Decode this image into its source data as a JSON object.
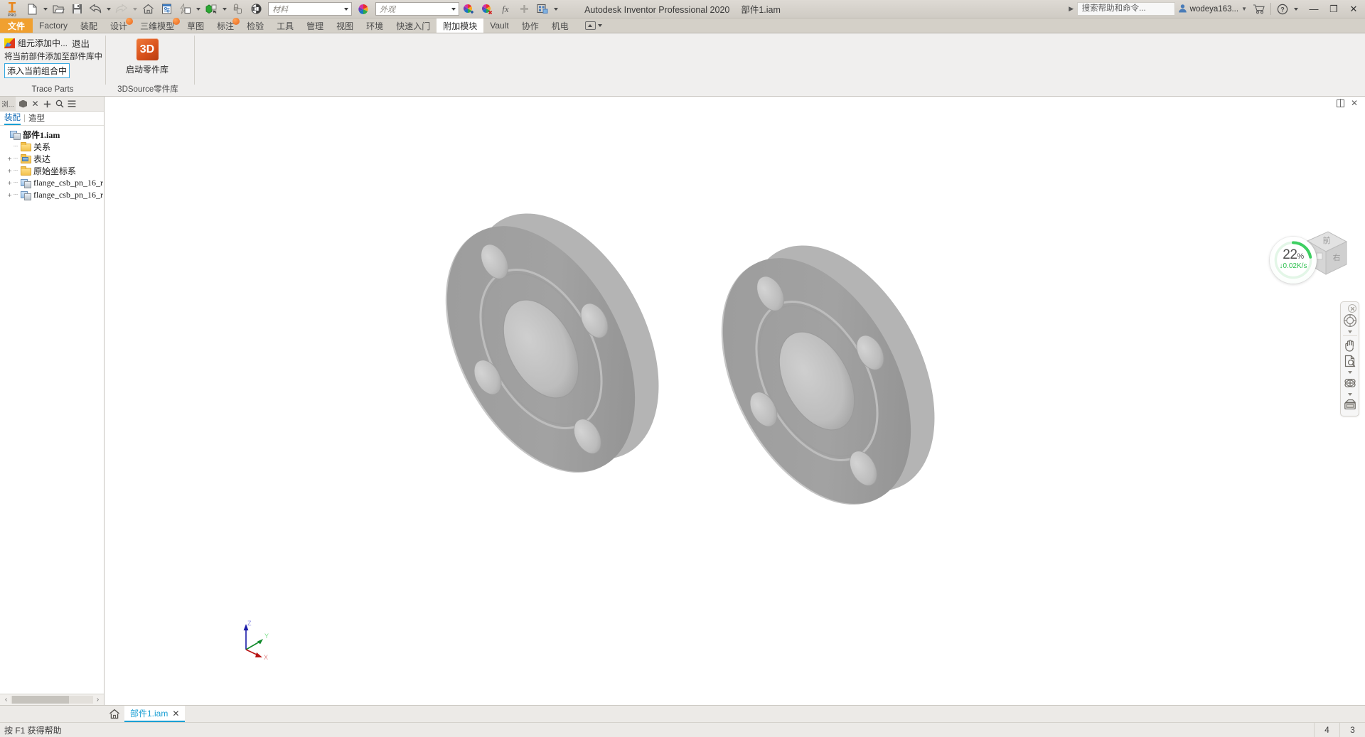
{
  "app": {
    "title": "Autodesk Inventor Professional 2020",
    "document_name": "部件1.iam"
  },
  "quick_access": {
    "logo_label": "PRO",
    "buttons": [
      {
        "name": "new-file",
        "icon": "new-document-icon"
      },
      {
        "name": "open-file",
        "icon": "open-folder-icon"
      },
      {
        "name": "save-file",
        "icon": "save-disk-icon"
      },
      {
        "name": "undo",
        "icon": "undo-arrow-icon"
      },
      {
        "name": "redo",
        "icon": "redo-arrow-icon"
      },
      {
        "name": "home-view",
        "icon": "home-icon"
      },
      {
        "name": "parameters",
        "icon": "parameters-icon"
      },
      {
        "name": "update",
        "icon": "update-lightning-icon"
      },
      {
        "name": "material-select",
        "icon": "material-box-icon"
      },
      {
        "name": "content-center",
        "icon": "content-center-icon"
      },
      {
        "name": "render-ball",
        "icon": "checker-ball-icon"
      }
    ],
    "material": {
      "label": "材料",
      "placeholder": "材料"
    },
    "appearance": {
      "label": "外观",
      "placeholder": "外观"
    },
    "right_buttons": [
      {
        "name": "adjust-appearance",
        "icon": "color-wheel-add-icon"
      },
      {
        "name": "clear-appearance",
        "icon": "color-wheel-remove-icon"
      },
      {
        "name": "fx-parameters",
        "icon": "fx-icon"
      },
      {
        "name": "add-plus",
        "icon": "plus-icon"
      },
      {
        "name": "component-library",
        "icon": "component-grid-icon"
      },
      {
        "name": "qat-overflow",
        "icon": "chevron-down-icon"
      }
    ]
  },
  "titlebar": {
    "search_placeholder": "搜索帮助和命令...",
    "search_arrow_icon": "triangle-right-icon",
    "user": "wodeya163...",
    "user_icon": "person-icon",
    "cart_icon": "shopping-cart-icon",
    "help_icon": "question-circle-icon",
    "minimize": "—",
    "maximize": "❐",
    "close": "✕"
  },
  "ribbon": {
    "tabs": [
      {
        "label": "文件",
        "type": "file",
        "active": false,
        "dot": false
      },
      {
        "label": "Factory",
        "active": false,
        "dot": false
      },
      {
        "label": "装配",
        "active": false,
        "dot": false
      },
      {
        "label": "设计",
        "active": false,
        "dot": true
      },
      {
        "label": "三维模型",
        "active": false,
        "dot": true
      },
      {
        "label": "草图",
        "active": false,
        "dot": false
      },
      {
        "label": "标注",
        "active": false,
        "dot": true
      },
      {
        "label": "检验",
        "active": false,
        "dot": false
      },
      {
        "label": "工具",
        "active": false,
        "dot": false
      },
      {
        "label": "管理",
        "active": false,
        "dot": false
      },
      {
        "label": "视图",
        "active": false,
        "dot": false
      },
      {
        "label": "环境",
        "active": false,
        "dot": false
      },
      {
        "label": "快速入门",
        "active": false,
        "dot": false
      },
      {
        "label": "附加模块",
        "active": true,
        "dot": false
      },
      {
        "label": "Vault",
        "active": false,
        "dot": false
      },
      {
        "label": "协作",
        "active": false,
        "dot": false
      },
      {
        "label": "机电",
        "active": false,
        "dot": false
      }
    ],
    "panels": [
      {
        "name": "trace-parts",
        "label": "Trace Parts",
        "row1_label": "组元添加中...",
        "exit_label": "退出",
        "description": "将当前部件添加至部件库中",
        "highlight_label": "添入当前组合中",
        "icon": "trace-parts-icon"
      },
      {
        "name": "3dsource",
        "label": "3DSource零件库",
        "button_label": "启动零件库",
        "icon": "3d-cube-icon",
        "icon_text": "3D"
      }
    ]
  },
  "browser": {
    "tab_tag": "浏...",
    "toolbar_buttons": [
      {
        "name": "model-cube",
        "icon": "cube-icon"
      },
      {
        "name": "close-browser",
        "icon": "close-icon",
        "glyph": "✕"
      },
      {
        "name": "add-item",
        "icon": "plus-icon",
        "glyph": "✛"
      },
      {
        "name": "search-browser",
        "icon": "search-icon",
        "glyph": "⌕"
      },
      {
        "name": "browser-menu",
        "icon": "hamburger-menu-icon",
        "glyph": "☰"
      }
    ],
    "subtabs": [
      {
        "label": "装配",
        "active": true
      },
      {
        "label": "造型",
        "active": false
      }
    ],
    "tree": [
      {
        "label": "部件1.iam",
        "depth": 0,
        "expander": "",
        "icon": "assembly-icon",
        "root": true
      },
      {
        "label": "关系",
        "depth": 1,
        "expander": "",
        "icon": "folder-icon"
      },
      {
        "label": "表达",
        "depth": 1,
        "expander": "+",
        "icon": "folder-representation-icon"
      },
      {
        "label": "原始坐标系",
        "depth": 1,
        "expander": "+",
        "icon": "folder-icon"
      },
      {
        "label": "flange_csb_pn_16_r",
        "depth": 1,
        "expander": "+",
        "icon": "assembly-icon"
      },
      {
        "label": "flange_csb_pn_16_r",
        "depth": 1,
        "expander": "+",
        "icon": "assembly-icon"
      }
    ],
    "scroll_left": "‹",
    "scroll_right": "›"
  },
  "viewport": {
    "panel_icons": [
      {
        "name": "split-view",
        "icon": "split-view-icon"
      },
      {
        "name": "close-view",
        "icon": "close-icon",
        "glyph": "✕"
      }
    ],
    "axes": {
      "z_label": "Z",
      "y_label": "Y",
      "x_label": "X",
      "z_color": "#1a1aa8",
      "y_color": "#0f8a2a",
      "x_color": "#b81414"
    },
    "models": [
      {
        "name": "flange-left",
        "part": "flange_csb_pn_16_r"
      },
      {
        "name": "flange-right",
        "part": "flange_csb_pn_16_r"
      }
    ]
  },
  "viewcube": {
    "name": "view-cube",
    "top_face_label": "前",
    "front_face_label": "右"
  },
  "network_widget": {
    "percent": "22",
    "percent_unit": "%",
    "speed": "0.02K/s",
    "speed_arrow": "↓",
    "accent_color": "#2ec04f",
    "progress": 22
  },
  "navbar": {
    "close_glyph": "⊗",
    "items": [
      {
        "name": "steering-wheel",
        "icon": "steering-wheel-icon"
      },
      {
        "name": "pan",
        "icon": "hand-pan-icon"
      },
      {
        "name": "zoom-window",
        "icon": "zoom-page-icon"
      },
      {
        "name": "free-orbit",
        "icon": "orbit-icon"
      },
      {
        "name": "look-at",
        "icon": "look-at-screen-icon"
      }
    ]
  },
  "doc_tabs": {
    "home_icon": "home-icon",
    "tabs": [
      {
        "label": "部件1.iam",
        "active": true,
        "close_glyph": "✕"
      }
    ]
  },
  "statusbar": {
    "message": "按 F1 获得帮助",
    "cells": [
      "4",
      "3"
    ]
  }
}
